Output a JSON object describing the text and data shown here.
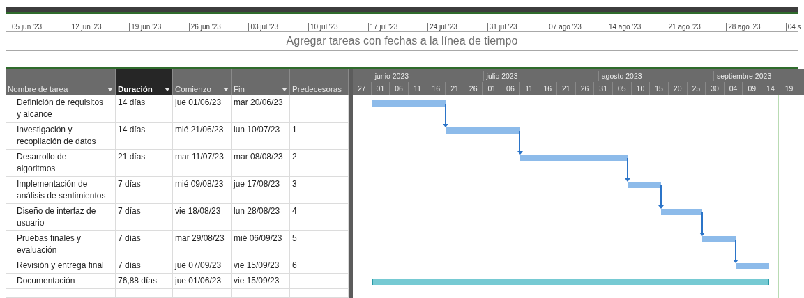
{
  "timeline": {
    "ticks": [
      "05 jun '23",
      "12 jun '23",
      "19 jun '23",
      "26 jun '23",
      "03 jul '23",
      "10 jul '23",
      "17 jul '23",
      "24 jul '23",
      "31 jul '23",
      "07 ago '23",
      "14 ago '23",
      "21 ago '23",
      "28 ago '23",
      "04 s"
    ],
    "placeholder": "Agregar tareas con fechas a la línea de tiempo"
  },
  "table": {
    "columns": [
      {
        "label": "Nombre de tarea",
        "selected": false,
        "has_menu": true
      },
      {
        "label": "Duración",
        "selected": true,
        "has_menu": true
      },
      {
        "label": "Comienzo",
        "selected": false,
        "has_menu": true
      },
      {
        "label": "Fin",
        "selected": false,
        "has_menu": true
      },
      {
        "label": "Predecesoras",
        "selected": false,
        "has_menu": false
      }
    ],
    "rows": [
      {
        "name": "Definición de requisitos y alcance",
        "duration": "14 días",
        "start": "jue 01/06/23",
        "finish": "mar 20/06/23",
        "predecessors": "",
        "color": "#8dbbea"
      },
      {
        "name": "Investigación y recopilación de datos",
        "duration": "14 días",
        "start": "mié 21/06/23",
        "finish": "lun 10/07/23",
        "predecessors": "1",
        "color": "#8dbbea"
      },
      {
        "name": "Desarrollo de algoritmos",
        "duration": "21 días",
        "start": "mar 11/07/23",
        "finish": "mar 08/08/23",
        "predecessors": "2",
        "color": "#8dbbea"
      },
      {
        "name": "Implementación de análisis de sentimientos",
        "duration": "7 días",
        "start": "mié 09/08/23",
        "finish": "jue 17/08/23",
        "predecessors": "3",
        "color": "#8dbbea"
      },
      {
        "name": "Diseño de interfaz de usuario",
        "duration": "7 días",
        "start": "vie 18/08/23",
        "finish": "lun 28/08/23",
        "predecessors": "4",
        "color": "#8dbbea"
      },
      {
        "name": "Pruebas finales y evaluación",
        "duration": "7 días",
        "start": "mar 29/08/23",
        "finish": "mié 06/09/23",
        "predecessors": "5",
        "color": "#8dbbea"
      },
      {
        "name": "Revisión y entrega final",
        "duration": "7 días",
        "start": "jue 07/09/23",
        "finish": "vie 15/09/23",
        "predecessors": "6",
        "color": "#8dbbea"
      },
      {
        "name": "Documentación",
        "duration": "76,88 días",
        "start": "jue 01/06/23",
        "finish": "vie 15/09/23",
        "predecessors": "",
        "color": "#76cad3"
      }
    ]
  },
  "gantt": {
    "months": [
      "junio 2023",
      "julio 2023",
      "agosto 2023",
      "septiembre 2023"
    ],
    "days": [
      "27",
      "01",
      "06",
      "11",
      "16",
      "21",
      "26",
      "01",
      "06",
      "11",
      "16",
      "21",
      "26",
      "31",
      "05",
      "10",
      "15",
      "20",
      "25",
      "30",
      "04",
      "09",
      "14",
      "19"
    ]
  }
}
